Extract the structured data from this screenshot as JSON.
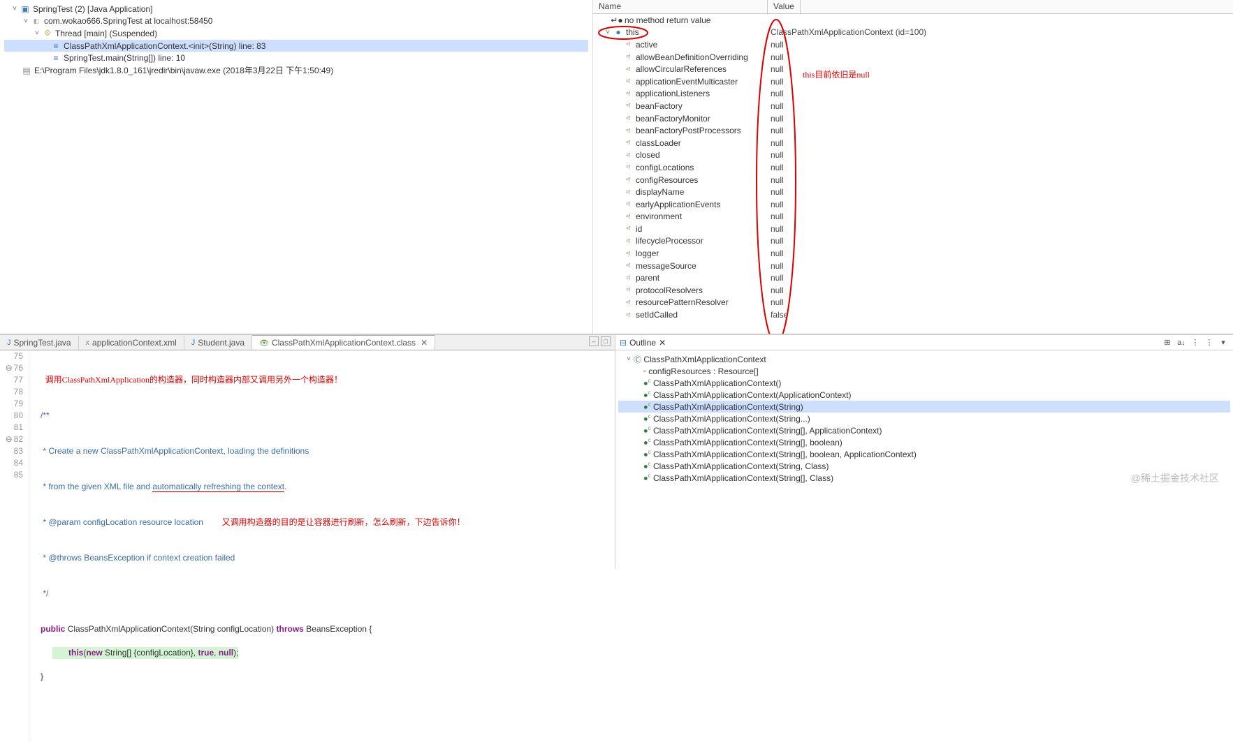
{
  "debug_tree": {
    "app": "SpringTest (2) [Java Application]",
    "process": "com.wokao666.SpringTest at localhost:58450",
    "thread": "Thread [main] (Suspended)",
    "frame1": "ClassPathXmlApplicationContext.<init>(String) line: 83",
    "frame2": "SpringTest.main(String[]) line: 10",
    "exe": "E:\\Program Files\\jdk1.8.0_161\\jredir\\bin\\javaw.exe (2018年3月22日 下午1:50:49)"
  },
  "vars_header": {
    "name": "Name",
    "value": "Value"
  },
  "vars": {
    "noreturn": "no method return value",
    "this": {
      "name": "this",
      "value": "ClassPathXmlApplicationContext  (id=100)"
    },
    "annotation_this": "this目前依旧是null",
    "fields": [
      {
        "name": "active",
        "value": "null"
      },
      {
        "name": "allowBeanDefinitionOverriding",
        "value": "null"
      },
      {
        "name": "allowCircularReferences",
        "value": "null"
      },
      {
        "name": "applicationEventMulticaster",
        "value": "null"
      },
      {
        "name": "applicationListeners",
        "value": "null"
      },
      {
        "name": "beanFactory",
        "value": "null"
      },
      {
        "name": "beanFactoryMonitor",
        "value": "null"
      },
      {
        "name": "beanFactoryPostProcessors",
        "value": "null"
      },
      {
        "name": "classLoader",
        "value": "null"
      },
      {
        "name": "closed",
        "value": "null"
      },
      {
        "name": "configLocations",
        "value": "null"
      },
      {
        "name": "configResources",
        "value": "null"
      },
      {
        "name": "displayName",
        "value": "null"
      },
      {
        "name": "earlyApplicationEvents",
        "value": "null"
      },
      {
        "name": "environment",
        "value": "null"
      },
      {
        "name": "id",
        "value": "null"
      },
      {
        "name": "lifecycleProcessor",
        "value": "null"
      },
      {
        "name": "logger",
        "value": "null"
      },
      {
        "name": "messageSource",
        "value": "null"
      },
      {
        "name": "parent",
        "value": "null"
      },
      {
        "name": "protocolResolvers",
        "value": "null"
      },
      {
        "name": "resourcePatternResolver",
        "value": "null"
      },
      {
        "name": "setIdCalled",
        "value": "false"
      }
    ]
  },
  "editor_tabs": {
    "t1": "SpringTest.java",
    "t2": "applicationContext.xml",
    "t3": "Student.java",
    "t4": "ClassPathXmlApplicationContext.class"
  },
  "code": {
    "ann1": "调用ClassPathXmlApplication的构造器，同时构造器内部又调用另外一个构造器！",
    "ann2": "又调用构造器的目的是让容器进行刷新，怎么刷新，下边告诉你！",
    "l75": "75",
    "l76": "76",
    "l77": "77",
    "l78": "78",
    "l79": "79",
    "l80": "80",
    "l81": "81",
    "l82": "82",
    "l83": "83",
    "l84": "84",
    "l85": "85",
    "c76": "   /**",
    "c77": "    * Create a new ClassPathXmlApplicationContext, loading the definitions",
    "c78_a": "    * from the given XML file and ",
    "c78_b": "automatically refreshing the context",
    "c78_c": ".",
    "c79": "    * @param configLocation resource location",
    "c80": "    * @throws BeansException if context creation failed",
    "c81": "    */",
    "c82_a": "public",
    "c82_b": " ClassPathXmlApplicationContext(String configLocation) ",
    "c82_c": "throws",
    "c82_d": " BeansException {",
    "c83_a": "this",
    "c83_b": "(",
    "c83_c": "new",
    "c83_d": " String[] {configLocation}, ",
    "c83_e": "true",
    "c83_f": ", ",
    "c83_g": "null",
    "c83_h": ");",
    "c84": "   }"
  },
  "outline": {
    "title": "Outline",
    "class": "ClassPathXmlApplicationContext",
    "field": "configResources : Resource[]",
    "methods": [
      "ClassPathXmlApplicationContext()",
      "ClassPathXmlApplicationContext(ApplicationContext)",
      "ClassPathXmlApplicationContext(String)",
      "ClassPathXmlApplicationContext(String...)",
      "ClassPathXmlApplicationContext(String[], ApplicationContext)",
      "ClassPathXmlApplicationContext(String[], boolean)",
      "ClassPathXmlApplicationContext(String[], boolean, ApplicationContext)",
      "ClassPathXmlApplicationContext(String, Class<?>)",
      "ClassPathXmlApplicationContext(String[], Class<?>)"
    ]
  },
  "watermark": "@稀土掘金技术社区"
}
